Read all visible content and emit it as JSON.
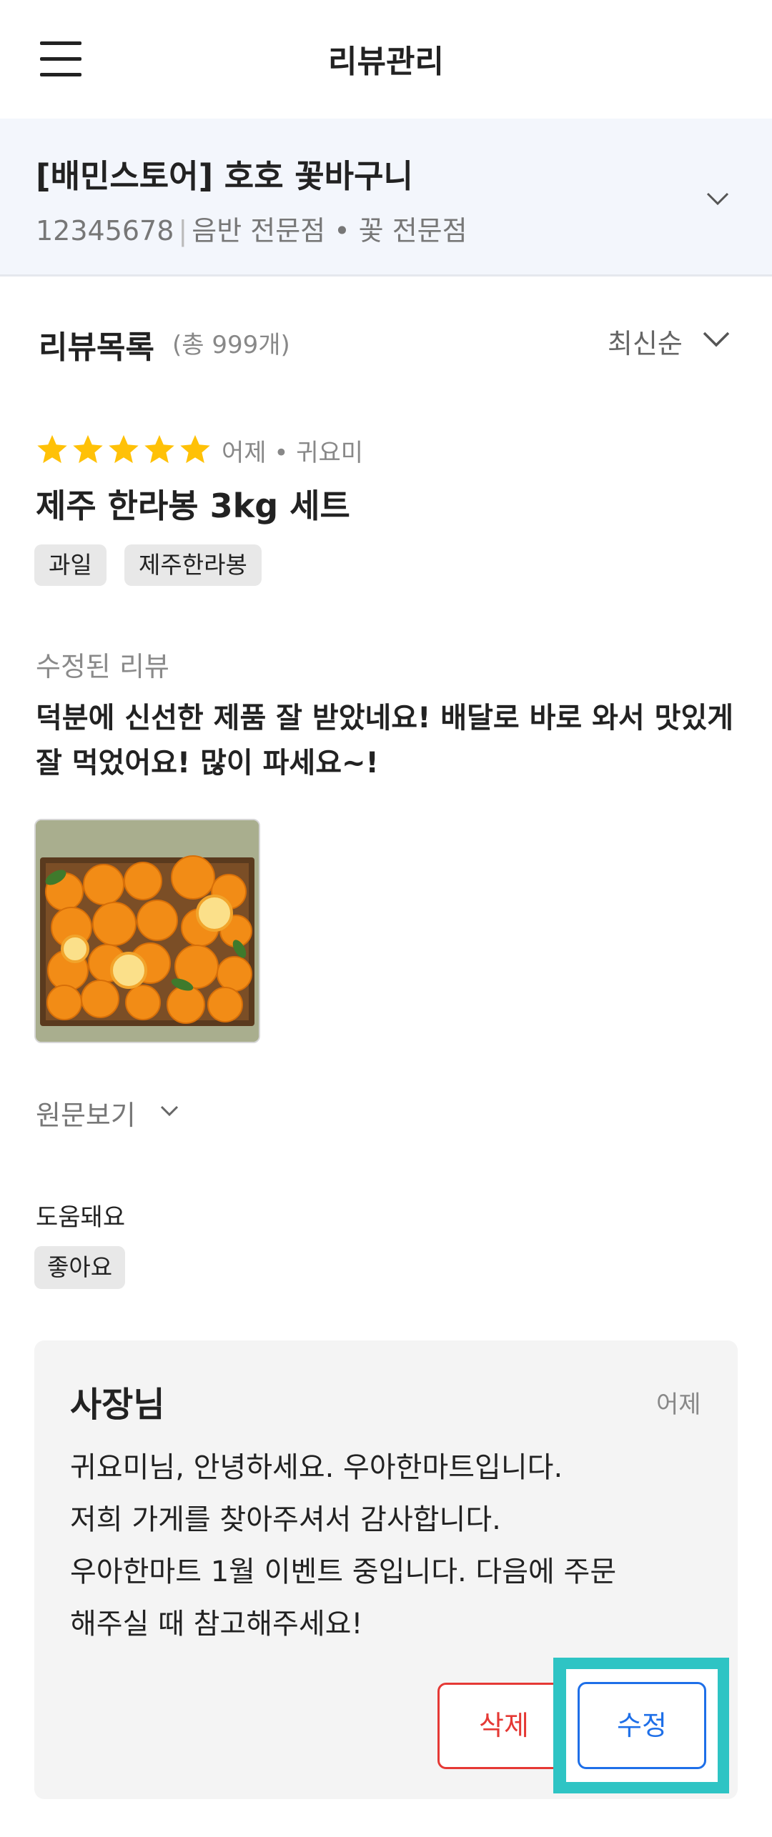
{
  "header": {
    "title": "리뷰관리",
    "menu_icon": "hamburger-menu-icon"
  },
  "store": {
    "name": "[배민스토어] 호호 꽃바구니",
    "id": "12345678",
    "categories": "음반 전문점 • 꽃 전문점",
    "chevron_icon": "chevron-down-icon"
  },
  "review_list": {
    "title": "리뷰목록",
    "count": "(총 999개)",
    "sort": "최신순"
  },
  "review": {
    "rating": 5,
    "meta": "어제 • 귀요미",
    "product": "제주 한라봉 3kg 세트",
    "tags": [
      "과일",
      "제주한라봉"
    ],
    "edited_label": "수정된 리뷰",
    "text": "덕분에 신선한 제품 잘 받았네요! 배달로 바로 와서 맛있게 잘 먹었어요! 많이 파세요~!",
    "original_label": "원문보기",
    "helpful_label": "도움돼요",
    "helpful_badge": "좋아요"
  },
  "reply": {
    "author": "사장님",
    "date": "어제",
    "lines": [
      "귀요미님, 안녕하세요. 우아한마트입니다.",
      "저희 가게를 찾아주셔서 감사합니다.",
      "우아한마트 1월 이벤트 중입니다. 다음에 주문",
      "해주실 때 참고해주세요!"
    ],
    "delete_label": "삭제",
    "edit_label": "수정"
  },
  "colors": {
    "star": "#ffc107",
    "delete": "#e53935",
    "edit": "#1e6fe8",
    "highlight": "#2ec4c4"
  }
}
